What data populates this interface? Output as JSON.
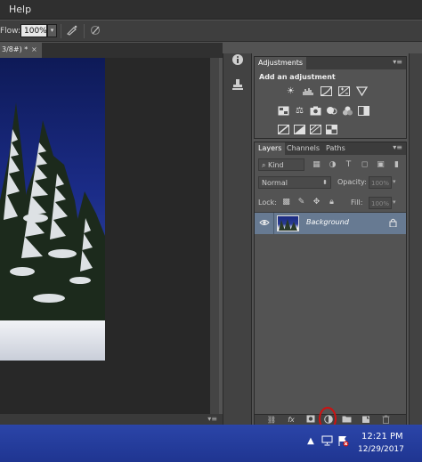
{
  "menubar": {
    "help_label": "Help"
  },
  "options_bar": {
    "flow_label": "Flow:",
    "flow_value": "100%",
    "dropdown_glyph": "▾",
    "airbrush_icon": "airbrush-icon",
    "pressure_icon": "pressure-size-icon"
  },
  "document": {
    "tab_title": "3/8#) *",
    "close_glyph": "×"
  },
  "dock": {
    "info_icon": "info-icon",
    "clone_source_icon": "clone-source-icon"
  },
  "adjustments": {
    "tab_label": "Adjustments",
    "title": "Add an adjustment",
    "menu_glyph": "▾≡",
    "icons": [
      "brightness-contrast-icon",
      "levels-icon",
      "curves-icon",
      "exposure-icon",
      "triangle-icon",
      "vibrance-icon",
      "balance-icon",
      "camera-icon",
      "mixer-icon",
      "color-lookup-icon",
      "invert-icon",
      "posterize-icon",
      "threshold-icon",
      "gradient-map-icon",
      "selective-color-icon"
    ]
  },
  "layers_panel": {
    "tabs": [
      "Layers",
      "Channels",
      "Paths"
    ],
    "menu_glyph": "▾≡",
    "kind_label": "⌕ Kind",
    "blend_mode": "Normal",
    "opacity_label": "Opacity:",
    "opacity_value": "100%",
    "lock_label": "Lock:",
    "fill_label": "Fill:",
    "fill_value": "100%",
    "layers": [
      {
        "name": "Background",
        "visible": true,
        "locked": true
      }
    ],
    "footer_icons": [
      "link-layers-icon",
      "fx-icon",
      "add-mask-icon",
      "new-adjustment-layer-icon",
      "new-group-icon",
      "new-layer-icon",
      "delete-layer-icon"
    ]
  },
  "hscroll_menu_glyph": "▾≡",
  "taskbar": {
    "time": "12:21 PM",
    "date": "12/29/2017"
  },
  "colors": {
    "highlight_layer": "#677a92",
    "taskbar": "#2b45a8",
    "annotation": "#d01010"
  }
}
